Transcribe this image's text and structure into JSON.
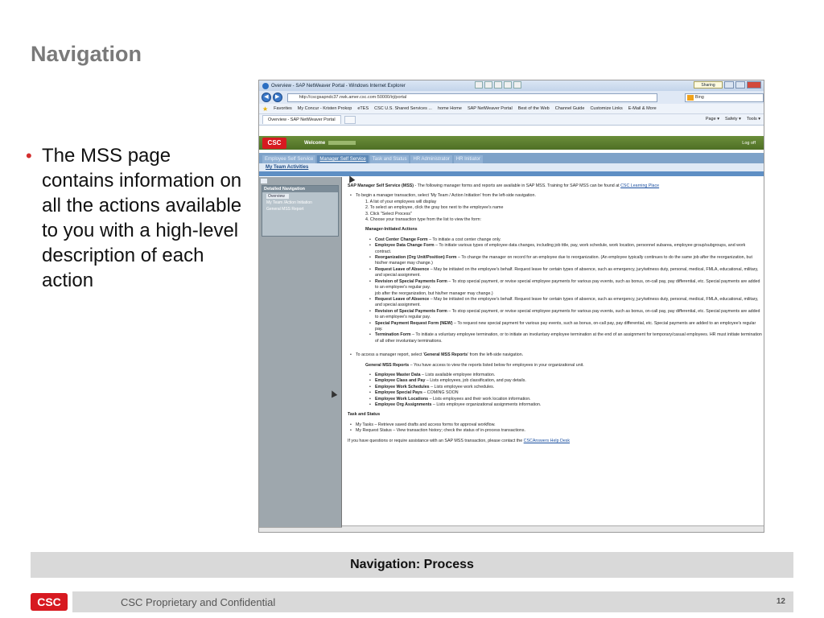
{
  "slide": {
    "title": "Navigation",
    "bullet": "The MSS page contains information on all the actions available to you with a high-level description of each action",
    "band_title": "Navigation: Process",
    "footer_logo": "CSC",
    "footer_text": "CSC Proprietary and Confidential",
    "page_number": "12"
  },
  "browser": {
    "window_title": "Overview - SAP NetWeaver Portal - Windows Internet Explorer",
    "sharing": "Sharing",
    "address": "http://cscgsapndc37.nwk.amer.csc.com:50000/irj/portal",
    "search_engine": "Bing",
    "favorites": {
      "label": "Favorites",
      "items": [
        "My Concur - Kristen Prokop",
        "eTES",
        "CSC U.S. Shared Services ...",
        "home Home",
        "SAP NetWeaver Portal",
        "Best of the Web",
        "Channel Guide",
        "Customize Links",
        "E-Mail & More"
      ]
    },
    "tab_title": "Overview - SAP NetWeaver Portal",
    "commands": [
      "Page ▾",
      "Safety ▾",
      "Tools ▾"
    ]
  },
  "portal": {
    "logo": "CSC",
    "welcome": "Welcome",
    "logoff": "Log off",
    "tabs": [
      "Employee Self Service",
      "Manager Self Service",
      "Task and Status",
      "HR Administrator",
      "HR Initiator"
    ],
    "subnav": "My Team Activities",
    "sidebar": {
      "header": "Detailed Navigation",
      "items": [
        "Overview",
        "My Team /Action Initiation",
        "General MSS Report"
      ]
    }
  },
  "content": {
    "intro_bold": "SAP Manager Self Service (MSS)",
    "intro_text": " - The following manager forms and reports are available in SAP MSS. Training for SAP MSS can be found at ",
    "intro_link": "CSC Learning Place",
    "begin_text": "To begin a manager transaction, select 'My Team / Action Initiation' from the left-side navigation.",
    "steps": [
      "1.   A list of your employees will display",
      "2.   To select an employee, click the gray box next to the employee's name",
      "3.   Click \"Select Process\"",
      "4.   Choose your transaction type from the list to view the form:"
    ],
    "manager_heading": "Manager-Initiated Actions",
    "actions": [
      {
        "name": "Cost Center Change Form",
        "desc": " – To initiate a cost center change only."
      },
      {
        "name": "Employee Data Change Form",
        "desc": " – To initiate various types of employee data changes, including job title, pay, work schedule, work location, personnel subarea, employee group/subgroups, and work contract."
      },
      {
        "name": "Reorganization (Org Unit/Position) Form",
        "desc": " – To change the manager on record for an employee due to reorganization. (An employee typically continues to do the same job after the reorganization, but his/her manager may change.)"
      },
      {
        "name": "Request Leave of Absence",
        "desc": " – May be initiated on the employee's behalf. Request leave for certain types of absence, such as emergency, jury/witness duty, personal, medical, FMLA, educational, military, and special assignment."
      },
      {
        "name": "Revision of Special Payments Form",
        "desc": " – To stop special payment, or revise special employee payments for various pay events, such as bonus, on-call pay, pay differential, etc. Special payments are added to an employee's regular pay."
      }
    ],
    "overlap_line": "job after the reorganization, but his/her manager may change.)",
    "actions2": [
      {
        "name": "Request Leave of Absence",
        "desc": " – May be initiated on the employee's behalf. Request leave for certain types of absence, such as emergency, jury/witness duty, personal, medical, FMLA, educational, military, and special assignment."
      },
      {
        "name": "Revision of Special Payments Form",
        "desc": " – To stop special payment, or revise special employee payments for various pay events, such as bonus, on-call pay, pay differential, etc. Special payments are added to an employee's regular pay."
      },
      {
        "name": "Special Payment Request Form (NEW)",
        "desc": " – To request new special payment for various pay events, such as bonus, on-call pay, pay differential, etc. Special payments are added to an employee's regular pay."
      },
      {
        "name": "Termination Form",
        "desc": " – To initiate a voluntary employee termination, or to initiate an involuntary employee termination at the end of an assignment for temporary/casual employees. HR must initiate termination of all other involuntary terminations."
      }
    ],
    "report_text_pre": "To access a manager report, select '",
    "report_text_bold": "General MSS Reports",
    "report_text_post": "' from the left-side navigation.",
    "general_bold": "General MSS Reports",
    "general_text": " – You have access to view the reports listed below for employees in your organizational unit.",
    "reports": [
      {
        "name": "Employee Master Data",
        "desc": " – Lists available employee information."
      },
      {
        "name": "Employee Class and Pay",
        "desc": " – Lists employees, job classification, and pay details."
      },
      {
        "name": "Employee Work Schedules",
        "desc": " – Lists employee work schedules."
      },
      {
        "name": "Employee Special Pays",
        "desc": " – COMING SOON"
      },
      {
        "name": "Employee Work Locations",
        "desc": " – Lists employees and their work location information."
      },
      {
        "name": "Employee Org Assignments",
        "desc": " – Lists employee organizational assignments information."
      }
    ],
    "task_heading": "Task and Status",
    "tasks": [
      "My Tasks – Retrieve saved drafts and access forms for approval workflow.",
      "My Request Status – View transaction history; check the status of in-process transactions."
    ],
    "questions_text": "If you have questions or require assistance with an SAP MSS transaction, please contact the ",
    "questions_link": "CSCAnswers Help Desk"
  }
}
